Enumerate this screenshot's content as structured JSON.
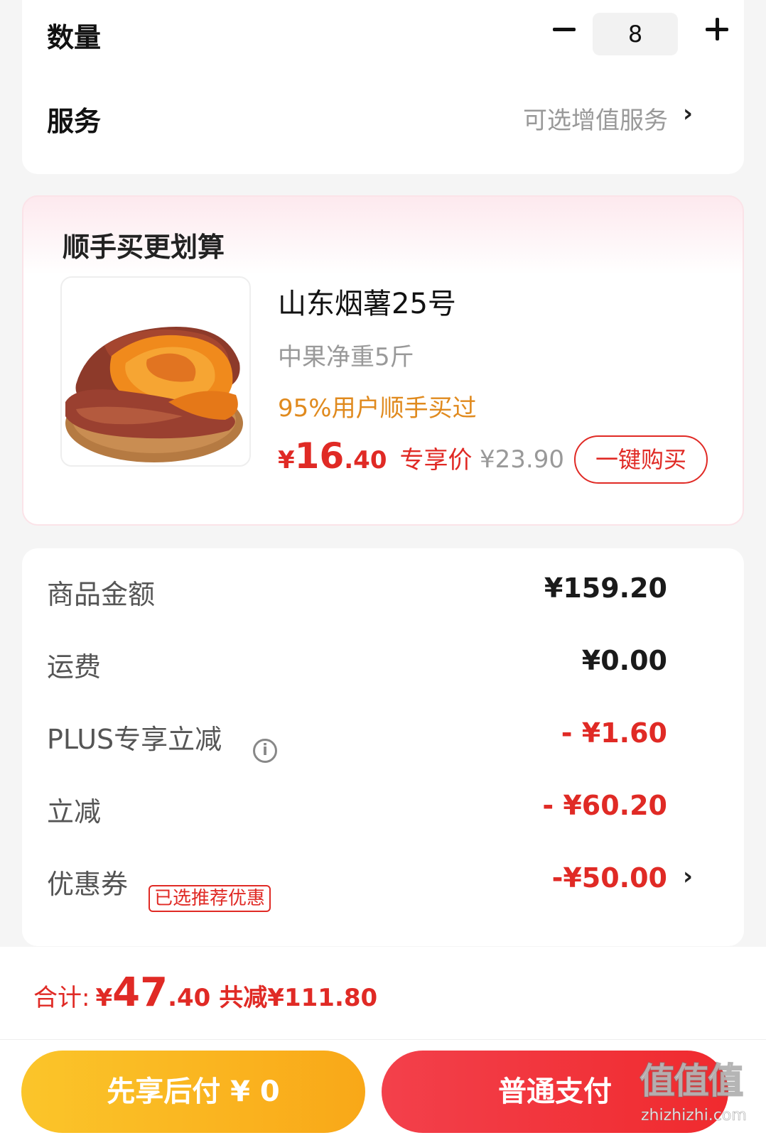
{
  "order": {
    "quantity_label": "数量",
    "quantity_value": "8",
    "service_label": "服务",
    "service_value": "可选增值服务"
  },
  "upsell": {
    "title": "顺手买更划算",
    "product": {
      "image": "roasted-sweet-potato-photo",
      "name": "山东烟薯25号",
      "spec": "中果净重5斤",
      "hint": "95%用户顺手买过",
      "price_yen": "¥",
      "price_int": "16",
      "price_dec": ".40",
      "price_tag": "专享价",
      "original_price": "¥23.90",
      "buy_button": "一键购买"
    }
  },
  "summary": {
    "rows": [
      {
        "label": "商品金额",
        "value": "¥159.20"
      },
      {
        "label": "运费",
        "value": "¥0.00"
      },
      {
        "label": "PLUS专享立减",
        "value": "- ¥1.60"
      },
      {
        "label": "立减",
        "value": "- ¥60.20"
      },
      {
        "label": "优惠券",
        "badge": "已选推荐优惠",
        "value": "-¥50.00"
      }
    ]
  },
  "footer": {
    "total_label": "合计:",
    "total_yen": "¥",
    "total_int": "47",
    "total_dec": ".40",
    "saved_text": "共减¥111.80",
    "pay_later_button": "先享后付 ¥ 0",
    "pay_button": "普通支付"
  },
  "watermark": {
    "logo_text": "值值值",
    "url": "zhizhizhi.com"
  },
  "colors": {
    "accent_red": "#e02a25",
    "hint_orange": "#e08a1e",
    "pay_later_yellow": "#fbc52a",
    "pay_red": "#f3404b"
  }
}
